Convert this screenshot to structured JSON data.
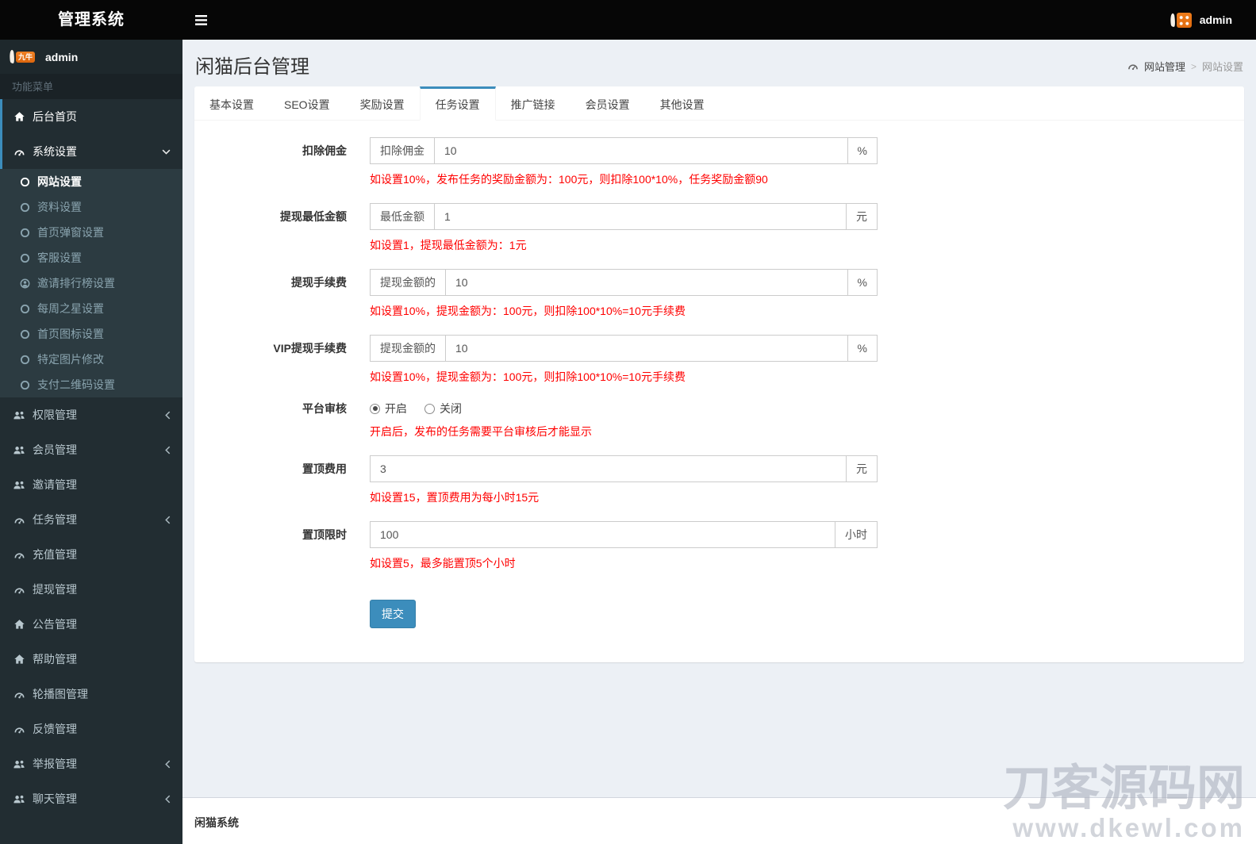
{
  "topbar": {
    "brand": "管理系统",
    "user": "admin"
  },
  "sidebar": {
    "user": "admin",
    "user_badge": "九牛",
    "menu_header": "功能菜单",
    "items": [
      {
        "key": "dashboard-home",
        "label": "后台首页",
        "icon": "home",
        "active": true
      },
      {
        "key": "system-settings",
        "label": "系统设置",
        "icon": "gauge",
        "arrow": "chevron-down",
        "active": true,
        "submenu": [
          {
            "key": "site-settings",
            "label": "网站设置",
            "icon": "circle-o",
            "active": true
          },
          {
            "key": "profile-settings",
            "label": "资料设置",
            "icon": "circle-o"
          },
          {
            "key": "home-popup-settings",
            "label": "首页弹窗设置",
            "icon": "circle-o"
          },
          {
            "key": "customer-service-settings",
            "label": "客服设置",
            "icon": "circle-o"
          },
          {
            "key": "invite-ranking-settings",
            "label": "邀请排行榜设置",
            "icon": "user-circle"
          },
          {
            "key": "weekly-star-settings",
            "label": "每周之星设置",
            "icon": "circle-o"
          },
          {
            "key": "home-icon-settings",
            "label": "首页图标设置",
            "icon": "circle-o"
          },
          {
            "key": "specific-image-edit",
            "label": "特定图片修改",
            "icon": "circle-o"
          },
          {
            "key": "payment-qrcode-settings",
            "label": "支付二维码设置",
            "icon": "circle-o"
          }
        ]
      },
      {
        "key": "permission-mgmt",
        "label": "权限管理",
        "icon": "users",
        "arrow": "chevron-left"
      },
      {
        "key": "member-mgmt",
        "label": "会员管理",
        "icon": "users",
        "arrow": "chevron-left"
      },
      {
        "key": "invite-mgmt",
        "label": "邀请管理",
        "icon": "users"
      },
      {
        "key": "task-mgmt",
        "label": "任务管理",
        "icon": "gauge",
        "arrow": "chevron-left"
      },
      {
        "key": "recharge-mgmt",
        "label": "充值管理",
        "icon": "gauge"
      },
      {
        "key": "withdraw-mgmt",
        "label": "提现管理",
        "icon": "gauge"
      },
      {
        "key": "announcement-mgmt",
        "label": "公告管理",
        "icon": "home"
      },
      {
        "key": "help-mgmt",
        "label": "帮助管理",
        "icon": "home"
      },
      {
        "key": "carousel-mgmt",
        "label": "轮播图管理",
        "icon": "gauge"
      },
      {
        "key": "feedback-mgmt",
        "label": "反馈管理",
        "icon": "gauge"
      },
      {
        "key": "report-mgmt",
        "label": "举报管理",
        "icon": "users",
        "arrow": "chevron-left"
      },
      {
        "key": "chat-mgmt",
        "label": "聊天管理",
        "icon": "users",
        "arrow": "chevron-left"
      }
    ]
  },
  "page": {
    "title": "闲猫后台管理",
    "breadcrumb_section": "网站管理",
    "breadcrumb_sep": ">",
    "breadcrumb_page": "网站设置"
  },
  "tabs": [
    {
      "key": "basic-settings",
      "label": "基本设置"
    },
    {
      "key": "seo-settings",
      "label": "SEO设置"
    },
    {
      "key": "reward-settings",
      "label": "奖励设置"
    },
    {
      "key": "task-settings",
      "label": "任务设置",
      "active": true
    },
    {
      "key": "promo-link",
      "label": "推广链接"
    },
    {
      "key": "member-settings",
      "label": "会员设置"
    },
    {
      "key": "other-settings",
      "label": "其他设置"
    }
  ],
  "form": {
    "rows": [
      {
        "key": "deduct-commission",
        "type": "input",
        "label": "扣除佣金",
        "prefix": "扣除佣金",
        "value": "10",
        "suffix": "%",
        "hint": "如设置10%，发布任务的奖励金额为：100元，则扣除100*10%，任务奖励金额90"
      },
      {
        "key": "withdraw-min",
        "type": "input",
        "label": "提现最低金额",
        "prefix": "最低金额",
        "value": "1",
        "suffix": "元",
        "hint": "如设置1，提现最低金额为：1元"
      },
      {
        "key": "withdraw-fee",
        "type": "input",
        "label": "提现手续费",
        "prefix": "提现金额的",
        "value": "10",
        "suffix": "%",
        "hint": "如设置10%，提现金额为：100元，则扣除100*10%=10元手续费"
      },
      {
        "key": "vip-withdraw-fee",
        "type": "input",
        "label": "VIP提现手续费",
        "prefix": "提现金额的",
        "value": "10",
        "suffix": "%",
        "hint": "如设置10%，提现金额为：100元，则扣除100*10%=10元手续费"
      },
      {
        "key": "platform-audit",
        "type": "radio",
        "label": "平台审核",
        "options": [
          {
            "label": "开启",
            "checked": true
          },
          {
            "label": "关闭",
            "checked": false
          }
        ],
        "hint": "开启后，发布的任务需要平台审核后才能显示"
      },
      {
        "key": "pin-fee",
        "type": "input",
        "label": "置顶费用",
        "value": "3",
        "suffix": "元",
        "hint": "如设置15，置顶费用为每小时15元"
      },
      {
        "key": "pin-hours",
        "type": "input",
        "label": "置顶限时",
        "value": "100",
        "suffix": "小时",
        "hint": "如设置5，最多能置顶5个小时"
      }
    ],
    "submit_label": "提交"
  },
  "footer": {
    "text": "闲猫系统"
  },
  "watermark": {
    "line1": "刀客源码网",
    "line2": "www.dkewl.com"
  },
  "colors": {
    "accent": "#3c8dbc",
    "hint_red": "#ff0000",
    "navbar_bg": "#060606",
    "sidebar_bg": "#222d32",
    "submenu_bg": "#2c3b41",
    "content_bg": "#ecf0f5",
    "badge_orange": "#ef7c1a"
  }
}
